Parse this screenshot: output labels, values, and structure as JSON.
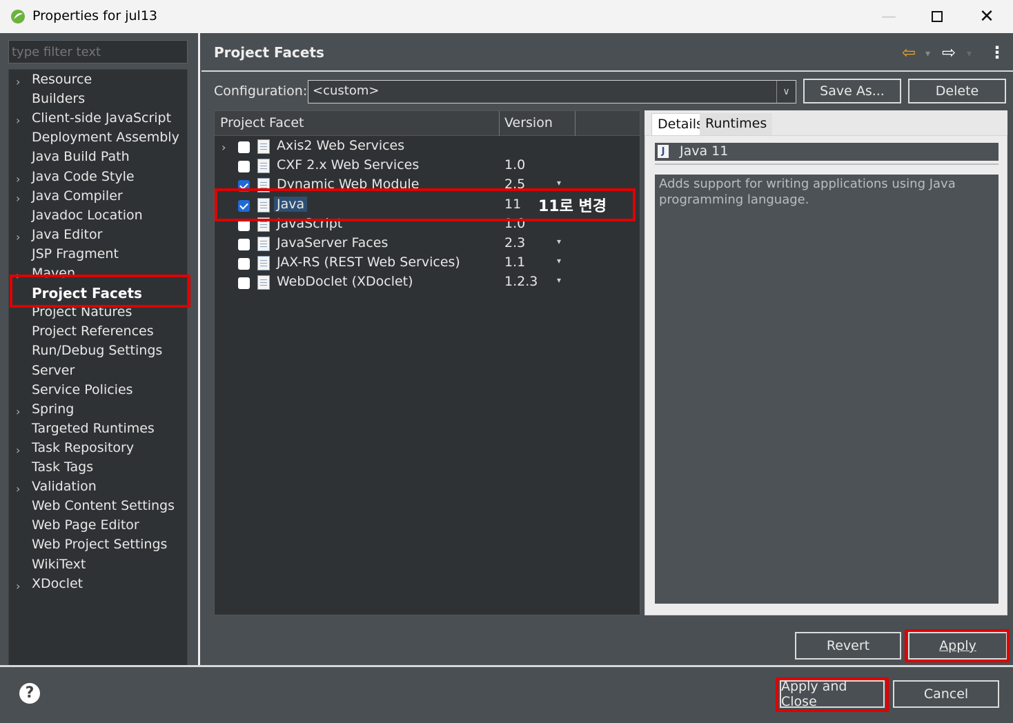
{
  "window": {
    "title": "Properties for jul13",
    "minimize_glyph": "—",
    "maximize_glyph": "☐",
    "close_glyph": "✕"
  },
  "filter": {
    "placeholder": "type filter text"
  },
  "tree": {
    "items": [
      {
        "label": "Resource",
        "expandable": true
      },
      {
        "label": "Builders",
        "expandable": false
      },
      {
        "label": "Client-side JavaScript",
        "expandable": true
      },
      {
        "label": "Deployment Assembly",
        "expandable": false
      },
      {
        "label": "Java Build Path",
        "expandable": false
      },
      {
        "label": "Java Code Style",
        "expandable": true
      },
      {
        "label": "Java Compiler",
        "expandable": true
      },
      {
        "label": "Javadoc Location",
        "expandable": false
      },
      {
        "label": "Java Editor",
        "expandable": true
      },
      {
        "label": "JSP Fragment",
        "expandable": false
      },
      {
        "label": "Maven",
        "expandable": true
      },
      {
        "label": "Project Facets",
        "expandable": false,
        "selected": true
      },
      {
        "label": "Project Natures",
        "expandable": false
      },
      {
        "label": "Project References",
        "expandable": false
      },
      {
        "label": "Run/Debug Settings",
        "expandable": false
      },
      {
        "label": "Server",
        "expandable": false
      },
      {
        "label": "Service Policies",
        "expandable": false
      },
      {
        "label": "Spring",
        "expandable": true
      },
      {
        "label": "Targeted Runtimes",
        "expandable": false
      },
      {
        "label": "Task Repository",
        "expandable": true
      },
      {
        "label": "Task Tags",
        "expandable": false
      },
      {
        "label": "Validation",
        "expandable": true
      },
      {
        "label": "Web Content Settings",
        "expandable": false
      },
      {
        "label": "Web Page Editor",
        "expandable": false
      },
      {
        "label": "Web Project Settings",
        "expandable": false
      },
      {
        "label": "WikiText",
        "expandable": false
      },
      {
        "label": "XDoclet",
        "expandable": true
      }
    ]
  },
  "page": {
    "title": "Project Facets",
    "nav": {
      "back": "⇦",
      "forward": "⇨",
      "menu": "⋮",
      "dropdown": "▾"
    }
  },
  "configuration": {
    "label": "Configuration:",
    "value": "<custom>",
    "save_as": "Save As...",
    "delete": "Delete"
  },
  "facets": {
    "headers": {
      "facet": "Project Facet",
      "version": "Version"
    },
    "rows": [
      {
        "name": "Axis2 Web Services",
        "version": "",
        "checked": false,
        "expander": true
      },
      {
        "name": "CXF 2.x Web Services",
        "version": "1.0",
        "checked": false
      },
      {
        "name": "Dynamic Web Module",
        "version": "2.5",
        "checked": true,
        "dropdown": true
      },
      {
        "name": "Java",
        "version": "11",
        "checked": true,
        "selected": true
      },
      {
        "name": "JavaScript",
        "version": "1.0",
        "checked": false
      },
      {
        "name": "JavaServer Faces",
        "version": "2.3",
        "checked": false,
        "dropdown": true
      },
      {
        "name": "JAX-RS (REST Web Services)",
        "version": "1.1",
        "checked": false,
        "dropdown": true
      },
      {
        "name": "WebDoclet (XDoclet)",
        "version": "1.2.3",
        "checked": false,
        "dropdown": true
      }
    ]
  },
  "annotation": {
    "text": "11로 변경"
  },
  "details": {
    "tabs": [
      "Details",
      "Runtimes"
    ],
    "facet_name": "Java 11",
    "description": "Adds support for writing applications using Java programming language."
  },
  "buttons": {
    "revert": "Revert",
    "apply": "Apply",
    "apply_and_close": "Apply and Close",
    "cancel": "Cancel",
    "help": "?"
  },
  "colors": {
    "panel_bg": "#4a4f53",
    "tree_bg": "#2f3234",
    "annotation_red": "#e00000",
    "checkbox_blue": "#1f6bd6"
  }
}
